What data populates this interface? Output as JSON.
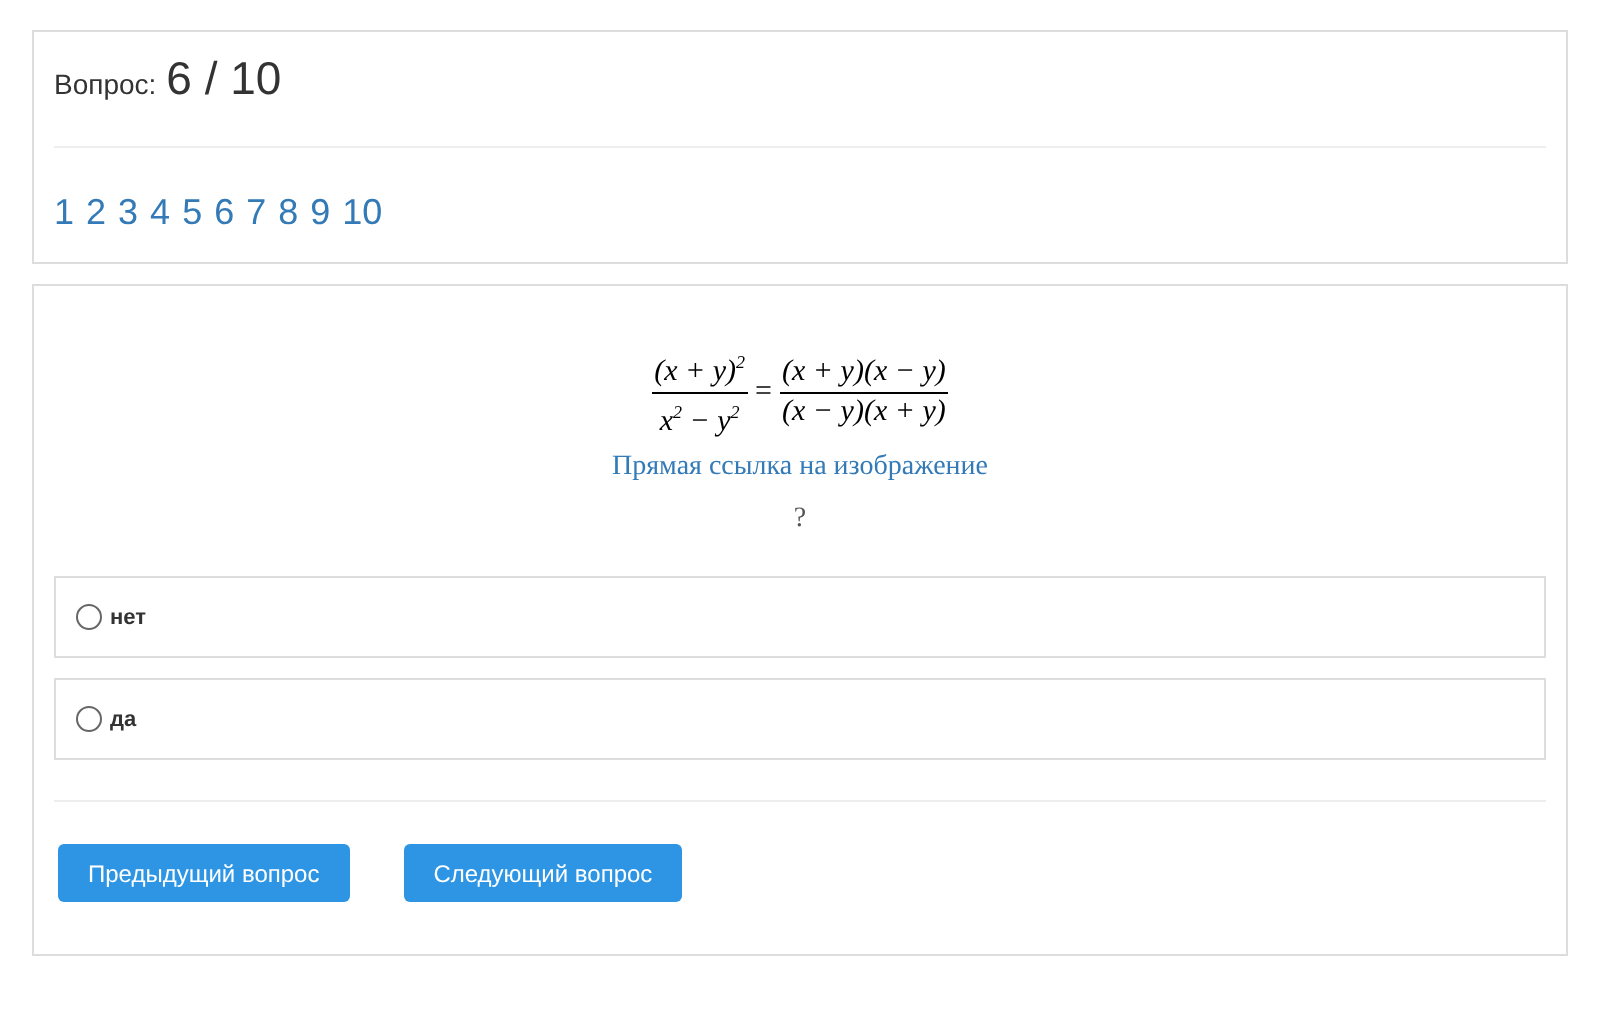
{
  "header": {
    "label": "Вопрос:",
    "counter": "6 / 10"
  },
  "pagination": [
    "1",
    "2",
    "3",
    "4",
    "5",
    "6",
    "7",
    "8",
    "9",
    "10"
  ],
  "question": {
    "formula": {
      "left": {
        "numerator": "(x + y)$^{2}$",
        "denominator": "x$^{2}$ − y$^{2}$"
      },
      "equals": "=",
      "right": {
        "numerator": "(x + y)(x − y)",
        "denominator": "(x − y)(x + y)"
      }
    },
    "image_link": "Прямая ссылка на изображение",
    "prompt": "?"
  },
  "options": [
    {
      "label": "нет",
      "selected": false
    },
    {
      "label": "да",
      "selected": false
    }
  ],
  "buttons": [
    "Предыдущий вопрос",
    "Следующий вопрос"
  ]
}
